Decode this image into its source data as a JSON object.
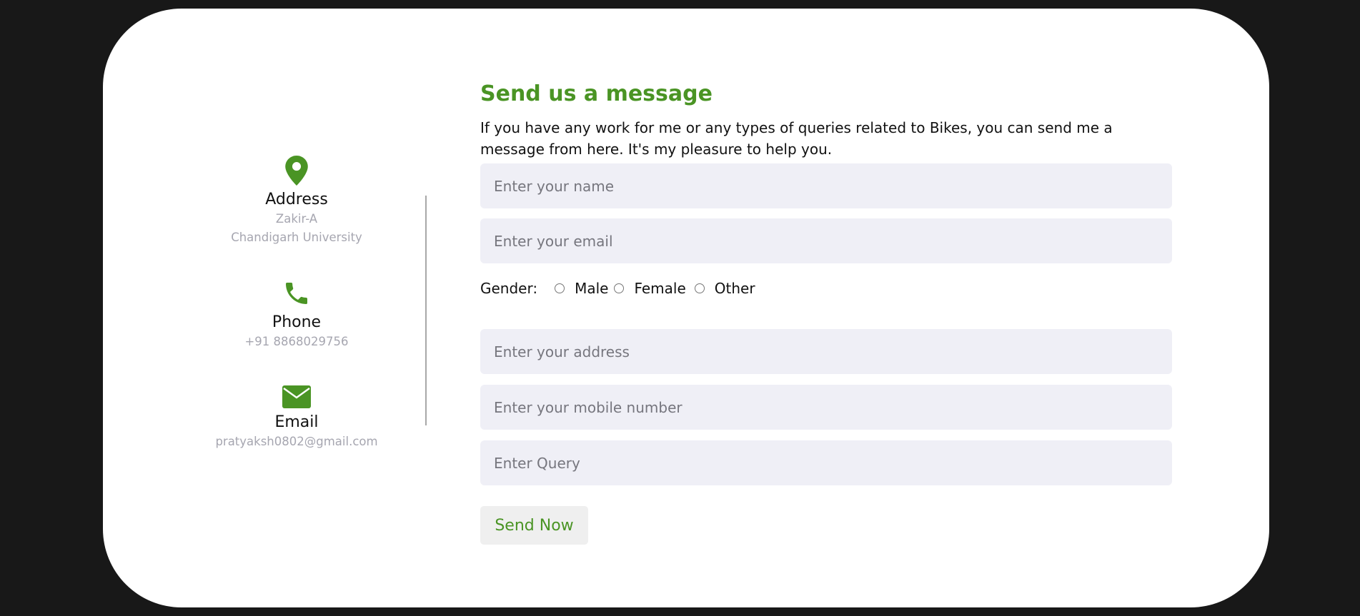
{
  "contact": {
    "address": {
      "icon": "map-pin-icon",
      "title": "Address",
      "line1": "Zakir-A",
      "line2": "Chandigarh University"
    },
    "phone": {
      "icon": "phone-icon",
      "title": "Phone",
      "value": "+91 8868029756"
    },
    "email": {
      "icon": "envelope-icon",
      "title": "Email",
      "value": "pratyaksh0802@gmail.com"
    }
  },
  "form": {
    "heading": "Send us a message",
    "description": "If you have any work for me or any types of queries related to Bikes, you can send me a message from here. It's my pleasure to help you.",
    "name_placeholder": "Enter your name",
    "email_placeholder": "Enter your email",
    "gender_label": "Gender:",
    "gender_options": [
      "Male",
      "Female",
      "Other"
    ],
    "address_placeholder": "Enter your address",
    "mobile_placeholder": "Enter your mobile number",
    "query_placeholder": "Enter Query",
    "submit_label": "Send Now"
  },
  "colors": {
    "accent": "#4a9424",
    "field_bg": "#efeff6",
    "page_bg": "#181818"
  }
}
